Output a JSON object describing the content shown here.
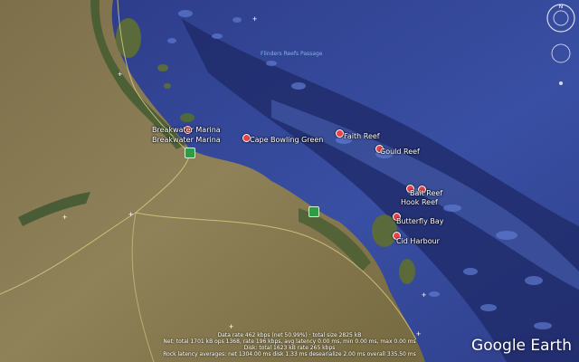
{
  "places": [
    {
      "id": "breakwater-marina-1",
      "label": "Breakwater Marina"
    },
    {
      "id": "breakwater-marina-2",
      "label": "Breakwater Marina"
    },
    {
      "id": "cape-bowling-green",
      "label": "Cape Bowling Green"
    },
    {
      "id": "faith-reef",
      "label": "Faith Reef"
    },
    {
      "id": "gould-reef",
      "label": "Gould Reef"
    },
    {
      "id": "bait-reef",
      "label": "Bait Reef"
    },
    {
      "id": "hook-reef",
      "label": "Hook Reef"
    },
    {
      "id": "butterfly-bay",
      "label": "Butterfly Bay"
    },
    {
      "id": "cid-harbour",
      "label": "Cid Harbour"
    }
  ],
  "passage_label": "Flinders Reefs Passage",
  "status": {
    "line1": "Data rate 462 kbps (net 50.99%) · total size 2825 kB",
    "line2": "Net: total 1701 kB ops 1368, rate 196 kbps, avg latency 0.00 ms, min 0.00 ms, max 0.00 ms",
    "line3": "Disk: total 1623 kB rate 265 kbps",
    "line4": "Rock latency averages: net 1304.00 ms disk 1.33 ms desearialize 2.00 ms overall 335.50 ms"
  },
  "brand": "Google Earth",
  "colors": {
    "deep_sea": "#2b3a7a",
    "shallow_sea": "#3d4f9c",
    "land": "#8a7a55",
    "pin": "#e8434a"
  }
}
